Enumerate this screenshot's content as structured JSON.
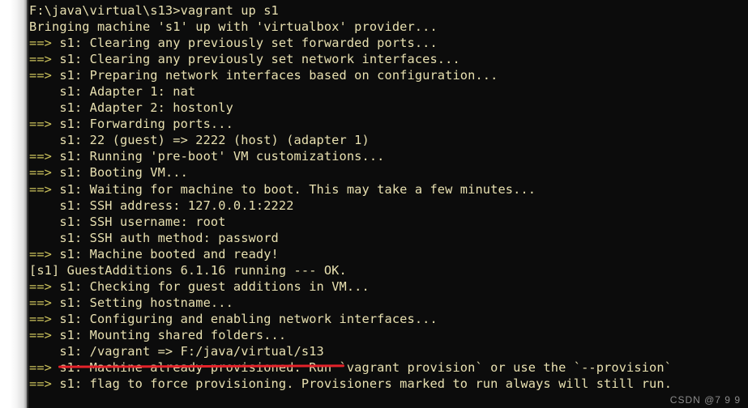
{
  "window": {
    "type": "windows-command-prompt",
    "background_color": "#0c0c0c",
    "text_color": "#e8e0b0",
    "accent_arrow_color": "#cdc35d",
    "annotation_color": "#e3222a",
    "page_strip_color": "#ffffff"
  },
  "prompt": {
    "path": "F:\\java\\virtual\\s13",
    "symbol": ">",
    "command": "vagrant up s1"
  },
  "console": {
    "lines": [
      "F:\\java\\virtual\\s13>vagrant up s1",
      "Bringing machine 's1' up with 'virtualbox' provider...",
      "==> s1: Clearing any previously set forwarded ports...",
      "==> s1: Clearing any previously set network interfaces...",
      "==> s1: Preparing network interfaces based on configuration...",
      "    s1: Adapter 1: nat",
      "    s1: Adapter 2: hostonly",
      "==> s1: Forwarding ports...",
      "    s1: 22 (guest) => 2222 (host) (adapter 1)",
      "==> s1: Running 'pre-boot' VM customizations...",
      "==> s1: Booting VM...",
      "==> s1: Waiting for machine to boot. This may take a few minutes...",
      "    s1: SSH address: 127.0.0.1:2222",
      "    s1: SSH username: root",
      "    s1: SSH auth method: password",
      "==> s1: Machine booted and ready!",
      "[s1] GuestAdditions 6.1.16 running --- OK.",
      "==> s1: Checking for guest additions in VM...",
      "==> s1: Setting hostname...",
      "==> s1: Configuring and enabling network interfaces...",
      "==> s1: Mounting shared folders...",
      "    s1: /vagrant => F:/java/virtual/s13",
      "==> s1: Machine already provisioned. Run `vagrant provision` or use the `--provision`",
      "==> s1: flag to force provisioning. Provisioners marked to run always will still run."
    ]
  },
  "annotation": {
    "type": "red-underline",
    "underlined_text": "s1: /vagrant => F:/java/virtual/s13",
    "line_index": 21
  },
  "watermark": {
    "text": "CSDN @7 9 9"
  }
}
